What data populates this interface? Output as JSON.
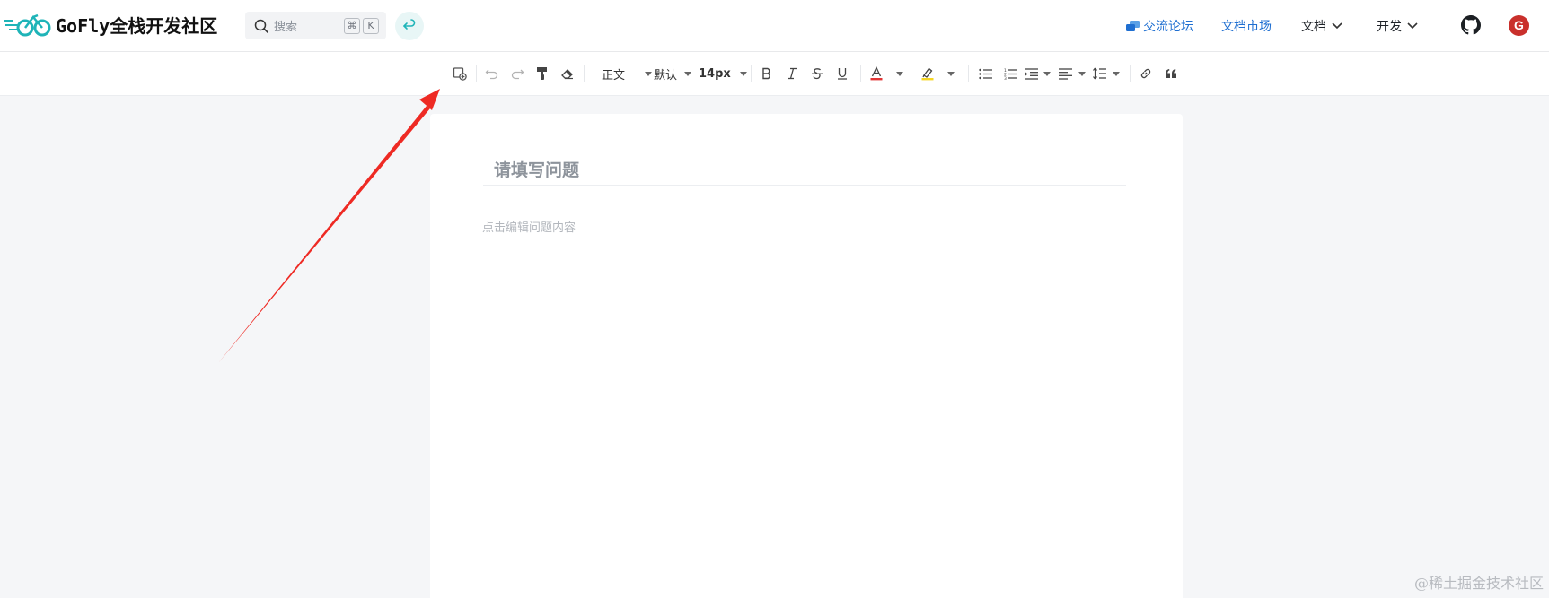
{
  "brand": {
    "name": "GoFly全栈开发社区"
  },
  "search": {
    "placeholder": "搜索",
    "shortcut_cmd": "⌘",
    "shortcut_key": "K"
  },
  "nav": {
    "forum": "交流论坛",
    "market": "文档市场",
    "docs": "文档",
    "dev": "开发"
  },
  "user": {
    "avatar_initial": "G"
  },
  "toolbar": {
    "paragraph_style": "正文",
    "font_family": "默认",
    "font_size": "14px",
    "colors": {
      "font_color_bar": "#e23636",
      "highlight_bar": "#f5d623"
    }
  },
  "editor": {
    "title_placeholder": "请填写问题",
    "content_placeholder": "点击编辑问题内容"
  },
  "watermark": "@稀土掘金技术社区",
  "colors": {
    "accent_teal": "#1fb4b8",
    "link_blue": "#1f6fd1",
    "arrow_red": "#ee2a24",
    "avatar_red": "#c9302c"
  }
}
